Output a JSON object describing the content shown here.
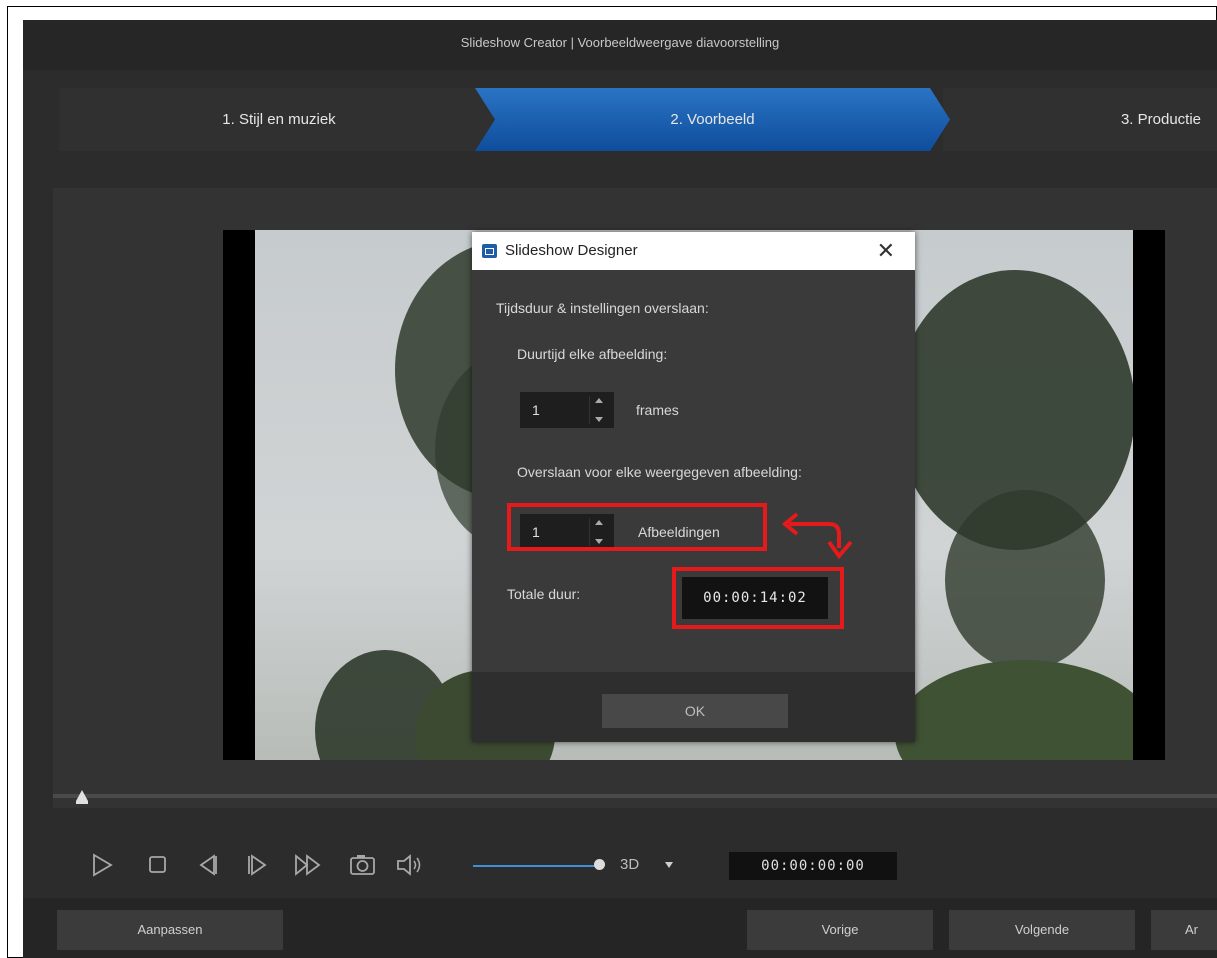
{
  "window": {
    "title": "Slideshow Creator | Voorbeeldweergave diavoorstelling"
  },
  "steps": [
    {
      "label": "1. Stijl en muziek"
    },
    {
      "label": "2. Voorbeeld"
    },
    {
      "label": "3. Productie"
    }
  ],
  "dialog": {
    "title": "Slideshow Designer",
    "section_label": "Tijdsduur & instellingen overslaan:",
    "duration_label": "Duurtijd elke afbeelding:",
    "duration_value": "1",
    "duration_unit": "frames",
    "skip_label": "Overslaan voor elke weergegeven afbeelding:",
    "skip_value": "1",
    "skip_unit": "Afbeeldingen",
    "total_label": "Totale duur:",
    "total_value": "00:00:14:02",
    "ok_label": "OK"
  },
  "player": {
    "timecode": "00:00:00:00",
    "mode_label": "3D",
    "icons": [
      "play-icon",
      "stop-icon",
      "previous-frame-icon",
      "next-frame-icon",
      "fast-forward-icon",
      "snapshot-icon",
      "volume-icon"
    ]
  },
  "buttons": {
    "customize": "Aanpassen",
    "previous": "Vorige",
    "next": "Volgende",
    "cut_off": "Ar"
  },
  "colors": {
    "accent": "#1a5fb4",
    "annotation": "#e51a1a"
  }
}
